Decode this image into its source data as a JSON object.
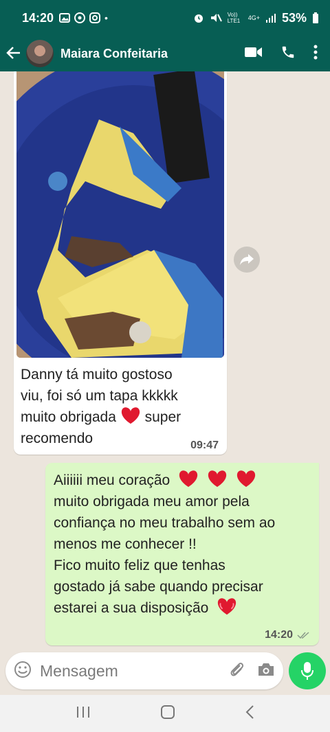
{
  "status": {
    "time": "14:20",
    "network": "4G+",
    "network_volte": "Vo)) LTE1",
    "battery": "53%"
  },
  "header": {
    "contact_name": "Maiara Confeitaria"
  },
  "messages": {
    "incoming": {
      "image_icon": "cake-photo",
      "text_line1": "Danny tá muito gostoso",
      "text_line2": "viu, foi só um tapa  kkkkk",
      "text_line3": "muito obrigada",
      "text_line3b": "super",
      "text_line4": "recomendo",
      "time": "09:47"
    },
    "outgoing": {
      "line1": "Aiiiiii meu coração",
      "line2": "muito obrigada meu amor pela",
      "line3": "confiança no meu trabalho sem ao",
      "line4": "menos me conhecer !!",
      "line5": "Fico muito feliz que tenhas",
      "line6": "gostado já sabe quando precisar",
      "line7": "estarei a sua disposição",
      "time": "14:20",
      "status": "read-double-check"
    }
  },
  "composer": {
    "placeholder": "Mensagem"
  },
  "colors": {
    "header": "#075e54",
    "chat_bg": "#ece5dd",
    "outgoing_bubble": "#dcf8c6",
    "mic_button": "#25d366"
  }
}
